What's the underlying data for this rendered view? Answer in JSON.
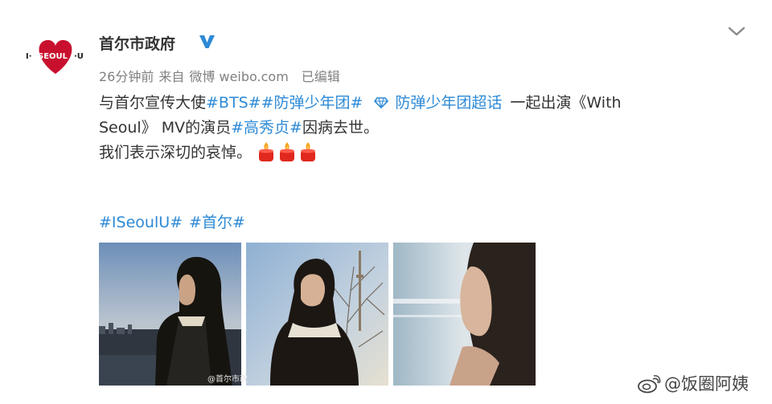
{
  "post": {
    "author": "首尔市政府",
    "verified_icon": "verified-v-icon",
    "time": "26分钟前",
    "from_label": "来自",
    "source": "微博 weibo.com",
    "edited": "已编辑",
    "content": {
      "seg1": "与首尔宣传大使",
      "tag_bts": "#BTS#",
      "tag_bts_cn": "#防弹少年团#",
      "supertopic_icon": "diamond-icon",
      "supertopic": "防弹少年团超话",
      "seg2": "一起出演《With",
      "seg3": "Seoul》 MV的演员",
      "tag_actor": "#高秀贞#",
      "seg4": "因病去世。",
      "seg5": "我们表示深切的哀悼。",
      "emoji": "candle-emoji"
    },
    "bottom_tags": [
      "#ISeoulU#",
      "#首尔#"
    ],
    "photo_watermark": "@首尔市政"
  },
  "avatar": {
    "left_text": "I·SEOUL·U"
  },
  "corner_watermark": "@饭圈阿姨",
  "colors": {
    "tag_blue": "#2e8ad6",
    "heart_red": "#c8102e",
    "meta_gray": "#808080"
  }
}
